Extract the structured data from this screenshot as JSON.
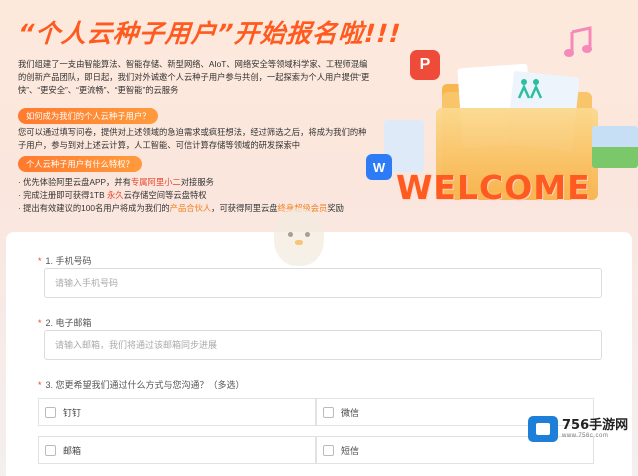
{
  "hero": {
    "title": "“个人云种子用户”开始报名啦!!!",
    "intro": "我们组建了一支由智能算法、智能存储、新型网络、AIoT、网络安全等领域科学家、工程师混编的创新产品团队，即日起，我们对外诚邀个人云种子用户参与共创，一起探索为个人用户提供“更快”、“更安全”、“更流畅”、“更智能”的云服务",
    "q1_pill": "如何成为我们的个人云种子用户？",
    "q1_text": "您可以通过填写问卷，提供对上述领域的急迫需求或疯狂想法，经过筛选之后，将成为我们的种子用户，参与到对上述云计算，人工智能、可信计算存储等领域的研发探索中",
    "q2_pill": "个人云种子用户有什么特权？",
    "benefits": [
      {
        "pre": "· 优先体验阿里云盘APP，并有",
        "hl": "专属阿里小二",
        "post": "对接服务"
      },
      {
        "pre": "· 完成注册即可获得1TB ",
        "hl": "永久",
        "post": "云存储空间等云盘特权"
      },
      {
        "pre": "· 提出有效建议的100名用户将成为我们的",
        "hl": "产品合伙人",
        "mid": "，可获得阿里云盘",
        "hl2": "终身超级会员",
        "post": "奖励"
      }
    ],
    "welcome": "WELCOME",
    "icon_p": "P",
    "icon_w": "W"
  },
  "form": {
    "q1": {
      "label": "1. 手机号码",
      "placeholder": "请输入手机号码"
    },
    "q2": {
      "label": "2. 电子邮箱",
      "placeholder": "请输入邮箱，我们将通过该邮箱同步进展"
    },
    "q3": {
      "label": "3. 您更希望我们通过什么方式与您沟通？（多选）",
      "options": [
        "钉钉",
        "微信",
        "邮箱",
        "短信"
      ]
    }
  },
  "watermark": {
    "name": "756手游网",
    "url": "www.756c.com"
  },
  "colors": {
    "accent": "#ff5a1f",
    "required": "#e8442a",
    "highlight": "#f0801c"
  }
}
